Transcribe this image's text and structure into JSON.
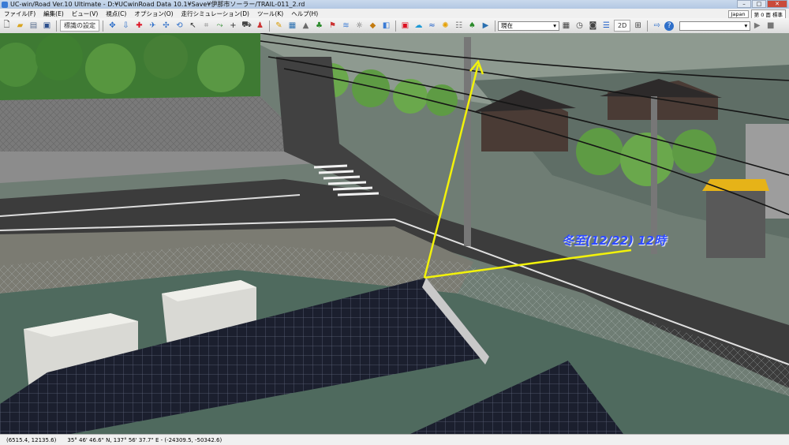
{
  "window": {
    "title": "UC-win/Road Ver.10 Ultimate - D:¥UCwinRoad Data 10.1¥Save¥伊那市ソーラー/TRAIL-011_2.rd"
  },
  "menu": [
    {
      "label": "ファイル(F)"
    },
    {
      "label": "編集(E)"
    },
    {
      "label": "ビュー(V)"
    },
    {
      "label": "視点(C)"
    },
    {
      "label": "オプション(O)"
    },
    {
      "label": "走行シミュレーション(D)"
    },
    {
      "label": "ツール(K)"
    },
    {
      "label": "ヘルプ(H)"
    }
  ],
  "menu_right": {
    "language": "Japan",
    "extra": "第 0 面 標準"
  },
  "toolbar": {
    "view_settings_label": "標識の設定",
    "time_select_value": "現在",
    "mode_label": "2D",
    "search_placeholder": ""
  },
  "scene": {
    "annotation": "冬至(12/22) 12時",
    "arrow_color": "#f2f20a"
  },
  "status": {
    "coords": "(6515.4, 12135.6)",
    "geo": "35°  46' 46.6\" N, 137°  56' 37.7\" E  -  (-24309.5, -50342.6)"
  }
}
